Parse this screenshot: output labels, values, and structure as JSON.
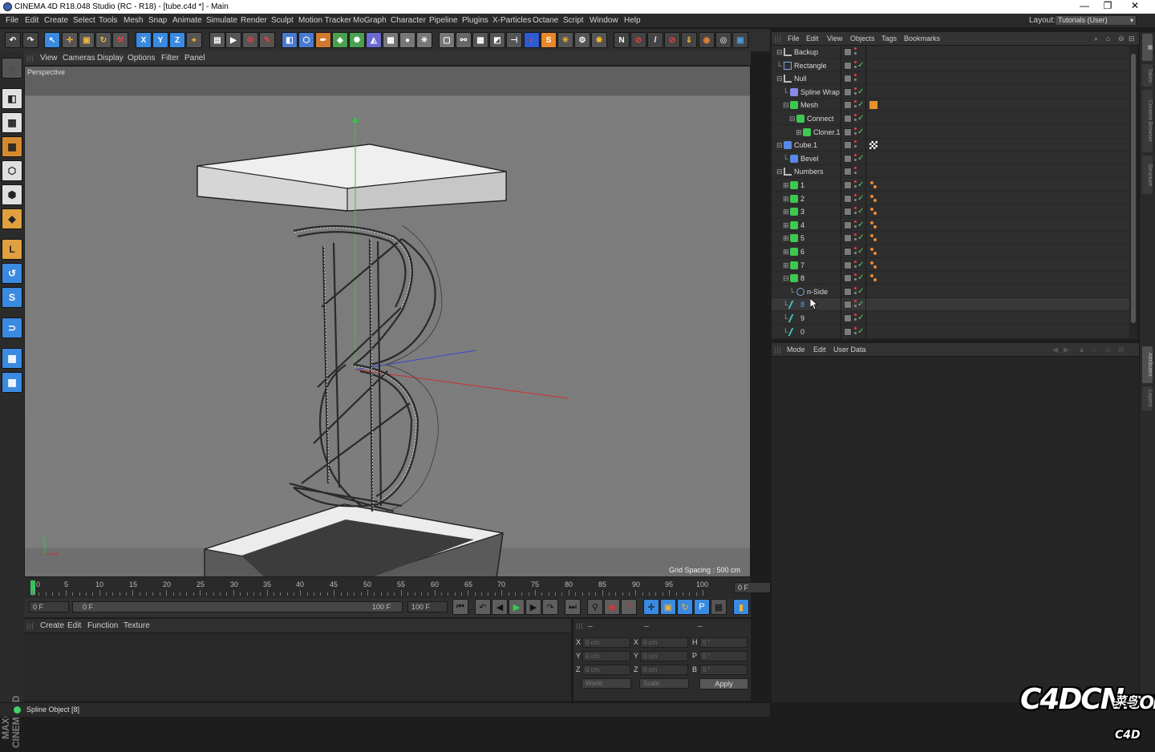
{
  "window": {
    "title": "CINEMA 4D R18.048 Studio (RC - R18) - [tube.c4d *] - Main",
    "minimize": "—",
    "maximize": "❐",
    "close": "✕"
  },
  "menubar": {
    "items": [
      "File",
      "Edit",
      "Create",
      "Select",
      "Tools",
      "Mesh",
      "Snap",
      "Animate",
      "Simulate",
      "Render",
      "Sculpt",
      "Motion Tracker",
      "MoGraph",
      "Character",
      "Pipeline",
      "Plugins",
      "X-Particles",
      "Octane",
      "Script",
      "Window",
      "Help"
    ],
    "layout_label": "Layout:",
    "layout_value": "Tutorials (User)"
  },
  "toolbar": {
    "axis_x": "X",
    "axis_y": "Y",
    "axis_z": "Z"
  },
  "viewport": {
    "menu": [
      "View",
      "Cameras",
      "Display",
      "Options",
      "Filter",
      "Panel"
    ],
    "label": "Perspective",
    "grid_spacing": "Grid Spacing : 500 cm",
    "axis_y": "y",
    "axis_x": "x"
  },
  "timeline": {
    "ticks": [
      "0",
      "5",
      "10",
      "15",
      "20",
      "25",
      "30",
      "35",
      "40",
      "45",
      "50",
      "55",
      "60",
      "65",
      "70",
      "75",
      "80",
      "85",
      "90",
      "95",
      "100"
    ],
    "current_frame": "0 F"
  },
  "transport": {
    "start_field": "0 F",
    "range_start": "0 F",
    "range_end": "100 F",
    "end_field": "100 F"
  },
  "material": {
    "menu": [
      "Create",
      "Edit",
      "Function",
      "Texture"
    ]
  },
  "coordinates": {
    "head_1": "--",
    "head_2": "--",
    "head_3": "--",
    "labels_pos": [
      "X",
      "Y",
      "Z"
    ],
    "labels_size": [
      "X",
      "Y",
      "Z"
    ],
    "labels_rot": [
      "H",
      "P",
      "B"
    ],
    "pos_values": [
      "0 cm",
      "0 cm",
      "0 cm"
    ],
    "size_values": [
      "0 cm",
      "0 cm",
      "0 cm"
    ],
    "rot_values": [
      "0 °",
      "0 °",
      "0 °"
    ],
    "mode_select": "World",
    "scale_select": "Scale",
    "apply": "Apply"
  },
  "objects": {
    "menu": [
      "File",
      "Edit",
      "View",
      "Objects",
      "Tags",
      "Bookmarks"
    ],
    "rows": [
      {
        "name": "Backup",
        "indent": 0,
        "icon": "null",
        "tree": "⊟",
        "check": "",
        "tag": ""
      },
      {
        "name": "Rectangle",
        "indent": 0,
        "icon": "rect",
        "tree": "",
        "check": "✓",
        "tag": ""
      },
      {
        "name": "Null",
        "indent": 0,
        "icon": "null",
        "tree": "⊟",
        "check": "",
        "tag": ""
      },
      {
        "name": "Spline Wrap",
        "indent": 1,
        "icon": "deform",
        "tree": "",
        "check": "✓",
        "tag": ""
      },
      {
        "name": "Mesh",
        "indent": 1,
        "icon": "green",
        "tree": "⊟",
        "check": "✓",
        "tag": "tex"
      },
      {
        "name": "Connect",
        "indent": 2,
        "icon": "green",
        "tree": "⊟",
        "check": "✓",
        "tag": ""
      },
      {
        "name": "Cloner.1",
        "indent": 3,
        "icon": "green",
        "tree": "⊞",
        "check": "✓",
        "tag": ""
      },
      {
        "name": "Cube.1",
        "indent": 0,
        "icon": "blue",
        "tree": "⊟",
        "check": "",
        "tag": "checker"
      },
      {
        "name": "Bevel",
        "indent": 1,
        "icon": "blue",
        "tree": "",
        "check": "✓",
        "tag": ""
      },
      {
        "name": "Numbers",
        "indent": 0,
        "icon": "null",
        "tree": "⊟",
        "check": "",
        "tag": ""
      },
      {
        "name": "1",
        "indent": 1,
        "icon": "green",
        "tree": "⊞",
        "check": "✓",
        "tag": "dots"
      },
      {
        "name": "2",
        "indent": 1,
        "icon": "green",
        "tree": "⊞",
        "check": "✓",
        "tag": "dots"
      },
      {
        "name": "3",
        "indent": 1,
        "icon": "green",
        "tree": "⊞",
        "check": "✓",
        "tag": "dots"
      },
      {
        "name": "4",
        "indent": 1,
        "icon": "green",
        "tree": "⊞",
        "check": "✓",
        "tag": "dots"
      },
      {
        "name": "5",
        "indent": 1,
        "icon": "green",
        "tree": "⊞",
        "check": "✓",
        "tag": "dots"
      },
      {
        "name": "6",
        "indent": 1,
        "icon": "green",
        "tree": "⊞",
        "check": "✓",
        "tag": "dots"
      },
      {
        "name": "7",
        "indent": 1,
        "icon": "green",
        "tree": "⊞",
        "check": "✓",
        "tag": "dots"
      },
      {
        "name": "8",
        "indent": 1,
        "icon": "green",
        "tree": "⊟",
        "check": "✓",
        "tag": "dots"
      },
      {
        "name": "n-Side",
        "indent": 2,
        "icon": "circle",
        "tree": "",
        "check": "✓",
        "tag": ""
      },
      {
        "name": "8",
        "indent": 1,
        "icon": "spline",
        "tree": "",
        "check": "✓",
        "tag": "",
        "selected": true
      },
      {
        "name": "9",
        "indent": 1,
        "icon": "spline",
        "tree": "",
        "check": "✓",
        "tag": ""
      },
      {
        "name": "0",
        "indent": 1,
        "icon": "spline",
        "tree": "",
        "check": "✓",
        "tag": ""
      }
    ]
  },
  "attributes": {
    "menu": [
      "Mode",
      "Edit",
      "User Data"
    ]
  },
  "status": {
    "text": "Spline Object [8]"
  },
  "sidetabs": [
    "Attributes",
    "Takes",
    "Content Browser",
    "Structure",
    "Layers"
  ],
  "watermark": {
    "main": "C4DCN",
    "com": ".COM",
    "cn": "菜鸟C4D"
  },
  "maxon": "MAXON CINEMA 4D"
}
